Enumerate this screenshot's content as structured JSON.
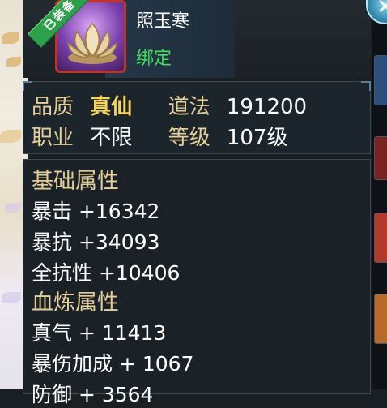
{
  "item": {
    "equipped_badge": "已装备",
    "name": "照玉寒",
    "bind_status": "绑定",
    "icon": "lotus-icon"
  },
  "info": {
    "quality_label": "品质",
    "quality_value": "真仙",
    "dao_label": "道法",
    "dao_value": "191200",
    "class_label": "职业",
    "class_value": "不限",
    "level_label": "等级",
    "level_value": "107级"
  },
  "base_attributes": {
    "title": "基础属性",
    "items": [
      "暴击 +16342",
      "暴抗 +34093",
      "全抗性 +10406"
    ]
  },
  "blood_attributes": {
    "title": "血炼属性",
    "items": [
      "真气 + 11413",
      "暴伤加成 + 1067",
      "防御 + 3564"
    ]
  },
  "colors": {
    "gold_label": "#e6ce97",
    "quality_gold": "#f4d75a",
    "bind_green": "#3ee05a",
    "frame_red": "#c0342c"
  },
  "icons": [
    "close-icon",
    "lotus-icon"
  ]
}
